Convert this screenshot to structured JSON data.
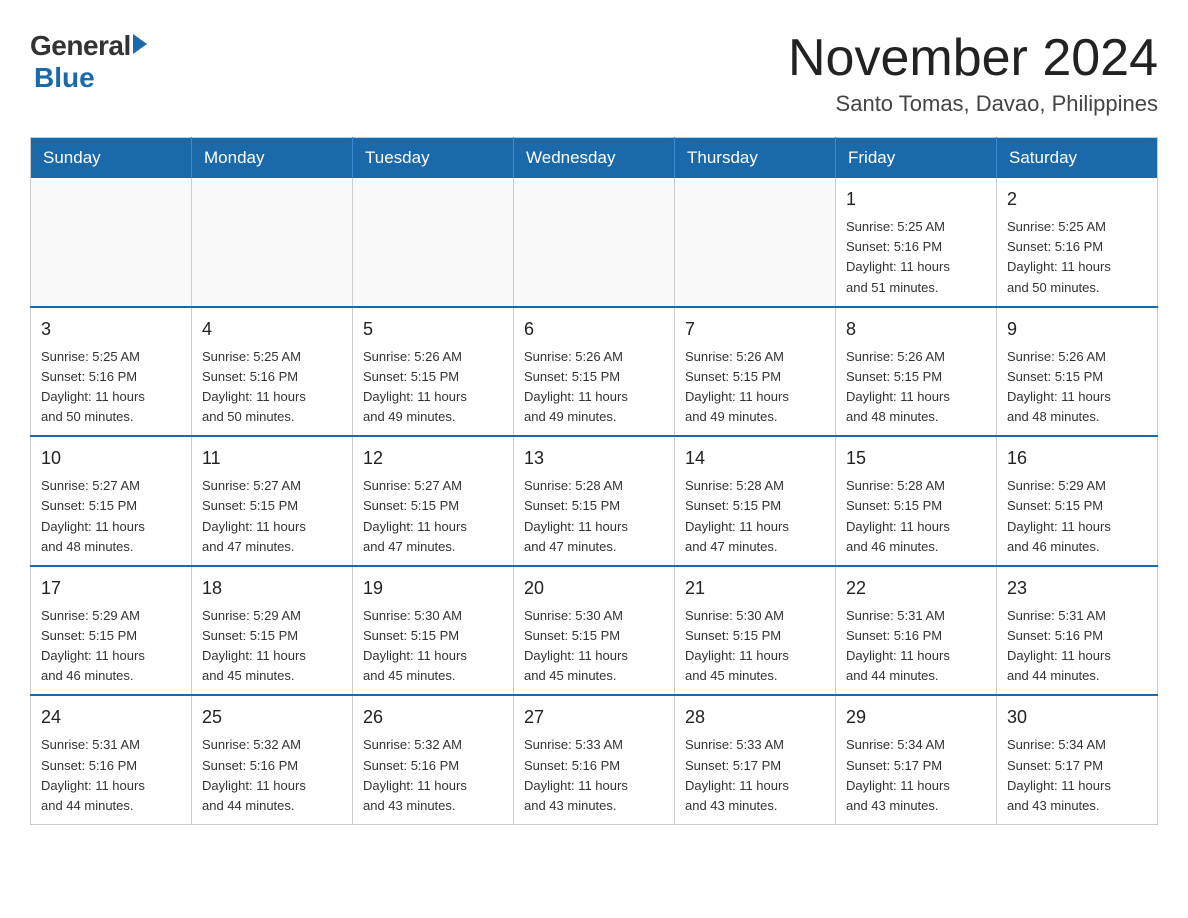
{
  "logo": {
    "general": "General",
    "blue": "Blue"
  },
  "title": "November 2024",
  "location": "Santo Tomas, Davao, Philippines",
  "days_of_week": [
    "Sunday",
    "Monday",
    "Tuesday",
    "Wednesday",
    "Thursday",
    "Friday",
    "Saturday"
  ],
  "weeks": [
    [
      {
        "day": "",
        "info": ""
      },
      {
        "day": "",
        "info": ""
      },
      {
        "day": "",
        "info": ""
      },
      {
        "day": "",
        "info": ""
      },
      {
        "day": "",
        "info": ""
      },
      {
        "day": "1",
        "info": "Sunrise: 5:25 AM\nSunset: 5:16 PM\nDaylight: 11 hours\nand 51 minutes."
      },
      {
        "day": "2",
        "info": "Sunrise: 5:25 AM\nSunset: 5:16 PM\nDaylight: 11 hours\nand 50 minutes."
      }
    ],
    [
      {
        "day": "3",
        "info": "Sunrise: 5:25 AM\nSunset: 5:16 PM\nDaylight: 11 hours\nand 50 minutes."
      },
      {
        "day": "4",
        "info": "Sunrise: 5:25 AM\nSunset: 5:16 PM\nDaylight: 11 hours\nand 50 minutes."
      },
      {
        "day": "5",
        "info": "Sunrise: 5:26 AM\nSunset: 5:15 PM\nDaylight: 11 hours\nand 49 minutes."
      },
      {
        "day": "6",
        "info": "Sunrise: 5:26 AM\nSunset: 5:15 PM\nDaylight: 11 hours\nand 49 minutes."
      },
      {
        "day": "7",
        "info": "Sunrise: 5:26 AM\nSunset: 5:15 PM\nDaylight: 11 hours\nand 49 minutes."
      },
      {
        "day": "8",
        "info": "Sunrise: 5:26 AM\nSunset: 5:15 PM\nDaylight: 11 hours\nand 48 minutes."
      },
      {
        "day": "9",
        "info": "Sunrise: 5:26 AM\nSunset: 5:15 PM\nDaylight: 11 hours\nand 48 minutes."
      }
    ],
    [
      {
        "day": "10",
        "info": "Sunrise: 5:27 AM\nSunset: 5:15 PM\nDaylight: 11 hours\nand 48 minutes."
      },
      {
        "day": "11",
        "info": "Sunrise: 5:27 AM\nSunset: 5:15 PM\nDaylight: 11 hours\nand 47 minutes."
      },
      {
        "day": "12",
        "info": "Sunrise: 5:27 AM\nSunset: 5:15 PM\nDaylight: 11 hours\nand 47 minutes."
      },
      {
        "day": "13",
        "info": "Sunrise: 5:28 AM\nSunset: 5:15 PM\nDaylight: 11 hours\nand 47 minutes."
      },
      {
        "day": "14",
        "info": "Sunrise: 5:28 AM\nSunset: 5:15 PM\nDaylight: 11 hours\nand 47 minutes."
      },
      {
        "day": "15",
        "info": "Sunrise: 5:28 AM\nSunset: 5:15 PM\nDaylight: 11 hours\nand 46 minutes."
      },
      {
        "day": "16",
        "info": "Sunrise: 5:29 AM\nSunset: 5:15 PM\nDaylight: 11 hours\nand 46 minutes."
      }
    ],
    [
      {
        "day": "17",
        "info": "Sunrise: 5:29 AM\nSunset: 5:15 PM\nDaylight: 11 hours\nand 46 minutes."
      },
      {
        "day": "18",
        "info": "Sunrise: 5:29 AM\nSunset: 5:15 PM\nDaylight: 11 hours\nand 45 minutes."
      },
      {
        "day": "19",
        "info": "Sunrise: 5:30 AM\nSunset: 5:15 PM\nDaylight: 11 hours\nand 45 minutes."
      },
      {
        "day": "20",
        "info": "Sunrise: 5:30 AM\nSunset: 5:15 PM\nDaylight: 11 hours\nand 45 minutes."
      },
      {
        "day": "21",
        "info": "Sunrise: 5:30 AM\nSunset: 5:15 PM\nDaylight: 11 hours\nand 45 minutes."
      },
      {
        "day": "22",
        "info": "Sunrise: 5:31 AM\nSunset: 5:16 PM\nDaylight: 11 hours\nand 44 minutes."
      },
      {
        "day": "23",
        "info": "Sunrise: 5:31 AM\nSunset: 5:16 PM\nDaylight: 11 hours\nand 44 minutes."
      }
    ],
    [
      {
        "day": "24",
        "info": "Sunrise: 5:31 AM\nSunset: 5:16 PM\nDaylight: 11 hours\nand 44 minutes."
      },
      {
        "day": "25",
        "info": "Sunrise: 5:32 AM\nSunset: 5:16 PM\nDaylight: 11 hours\nand 44 minutes."
      },
      {
        "day": "26",
        "info": "Sunrise: 5:32 AM\nSunset: 5:16 PM\nDaylight: 11 hours\nand 43 minutes."
      },
      {
        "day": "27",
        "info": "Sunrise: 5:33 AM\nSunset: 5:16 PM\nDaylight: 11 hours\nand 43 minutes."
      },
      {
        "day": "28",
        "info": "Sunrise: 5:33 AM\nSunset: 5:17 PM\nDaylight: 11 hours\nand 43 minutes."
      },
      {
        "day": "29",
        "info": "Sunrise: 5:34 AM\nSunset: 5:17 PM\nDaylight: 11 hours\nand 43 minutes."
      },
      {
        "day": "30",
        "info": "Sunrise: 5:34 AM\nSunset: 5:17 PM\nDaylight: 11 hours\nand 43 minutes."
      }
    ]
  ]
}
